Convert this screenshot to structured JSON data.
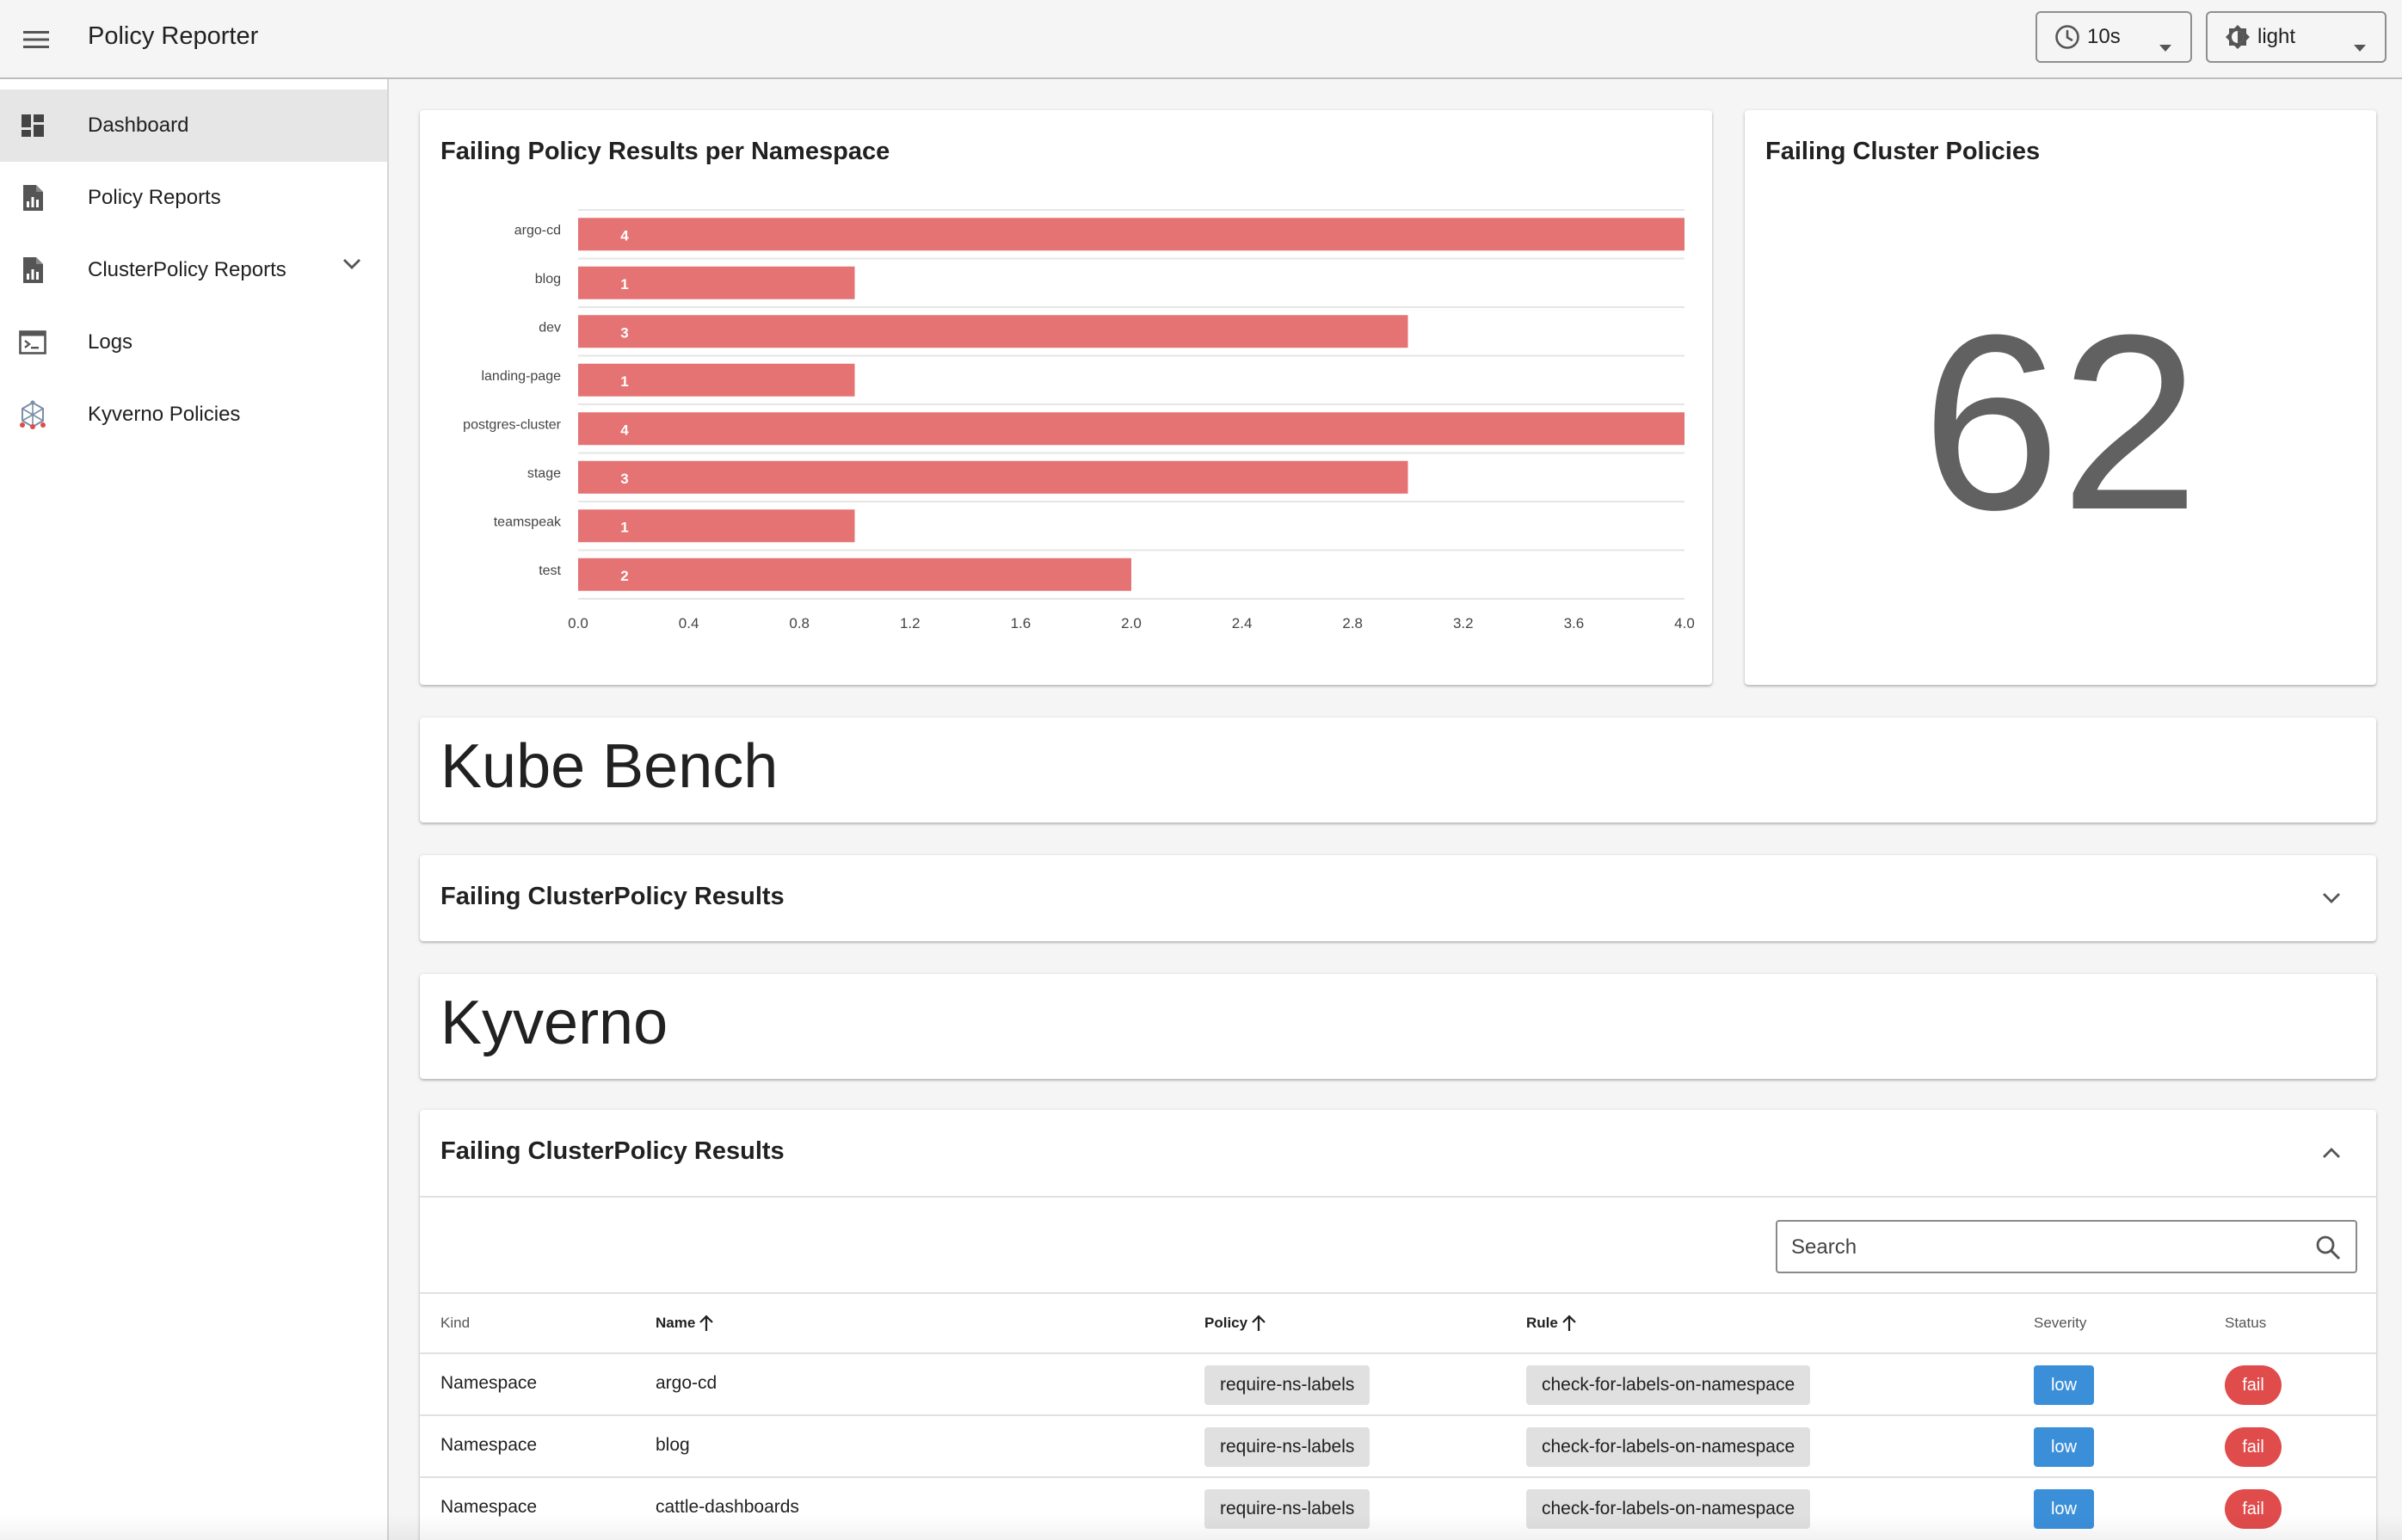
{
  "app": {
    "title": "Policy Reporter",
    "refresh": {
      "value": "10s"
    },
    "theme": {
      "value": "light"
    }
  },
  "sidebar": {
    "items": [
      {
        "label": "Dashboard",
        "icon": "dashboard-icon",
        "active": true
      },
      {
        "label": "Policy Reports",
        "icon": "report-icon"
      },
      {
        "label": "ClusterPolicy Reports",
        "icon": "report-icon",
        "expandable": true
      },
      {
        "label": "Logs",
        "icon": "terminal-icon"
      },
      {
        "label": "Kyverno Policies",
        "icon": "kyverno-icon"
      }
    ]
  },
  "cards": {
    "namespace_chart_title": "Failing Policy Results per Namespace",
    "cluster_policies_title": "Failing Cluster Policies",
    "cluster_policies_count": "62"
  },
  "chart_data": {
    "type": "bar",
    "orientation": "horizontal",
    "title": "Failing Policy Results per Namespace",
    "categories": [
      "argo-cd",
      "blog",
      "dev",
      "landing-page",
      "postgres-cluster",
      "stage",
      "teamspeak",
      "test"
    ],
    "values": [
      4,
      1,
      3,
      1,
      4,
      3,
      1,
      2
    ],
    "xlim": [
      0,
      4
    ],
    "x_ticks": [
      "0.0",
      "0.4",
      "0.8",
      "1.2",
      "1.6",
      "2.0",
      "2.4",
      "2.8",
      "3.2",
      "3.6",
      "4.0"
    ],
    "bar_color": "#e57373",
    "grid": true
  },
  "sections": {
    "kube_bench": {
      "title": "Kube Bench",
      "panel_title": "Failing ClusterPolicy Results"
    },
    "kyverno": {
      "title": "Kyverno",
      "panel_title": "Failing ClusterPolicy Results",
      "search_placeholder": "Search",
      "columns": [
        "Kind",
        "Name",
        "Policy",
        "Rule",
        "Severity",
        "Status"
      ],
      "rows": [
        {
          "kind": "Namespace",
          "name": "argo-cd",
          "policy": "require-ns-labels",
          "rule": "check-for-labels-on-namespace",
          "severity": "low",
          "status": "fail"
        },
        {
          "kind": "Namespace",
          "name": "blog",
          "policy": "require-ns-labels",
          "rule": "check-for-labels-on-namespace",
          "severity": "low",
          "status": "fail"
        },
        {
          "kind": "Namespace",
          "name": "cattle-dashboards",
          "policy": "require-ns-labels",
          "rule": "check-for-labels-on-namespace",
          "severity": "low",
          "status": "fail"
        }
      ]
    }
  },
  "colors": {
    "bar": "#e57373",
    "severity_low": "#3b8fd9",
    "status_fail": "#e04b4b"
  }
}
